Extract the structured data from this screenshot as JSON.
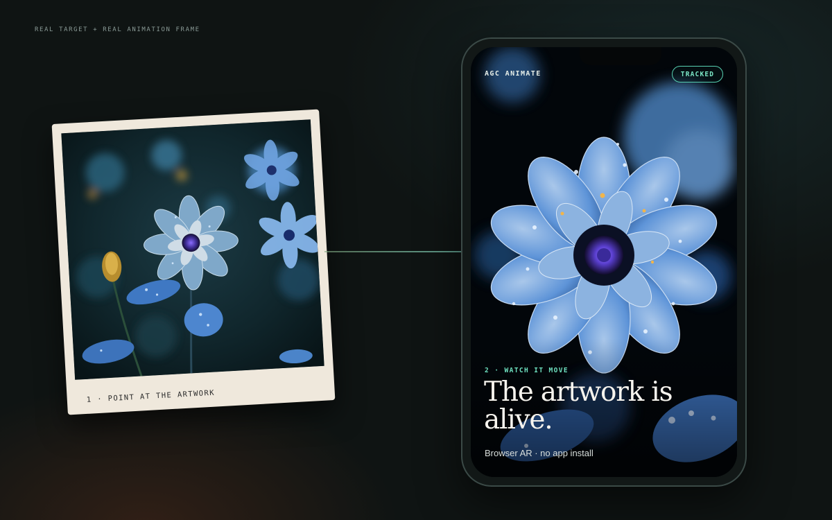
{
  "eyebrow": "REAL TARGET + REAL ANIMATION FRAME",
  "polaroid": {
    "caption": "1 · POINT AT THE ARTWORK",
    "image": "blue-flower-photo"
  },
  "phone": {
    "brand": "AGC ANIMATE",
    "status_badge": "TRACKED",
    "step_label": "2 · WATCH IT MOVE",
    "headline": "The artwork is alive.",
    "subtext": "Browser AR · no app install",
    "image": "animated-blue-flower-frame"
  },
  "colors": {
    "accent": "#6ee0bf",
    "background": "#0f1413",
    "polaroid_frame": "#efe8dc",
    "petal_blue": "#5e94d8",
    "flower_center": "#5a3fcf"
  }
}
